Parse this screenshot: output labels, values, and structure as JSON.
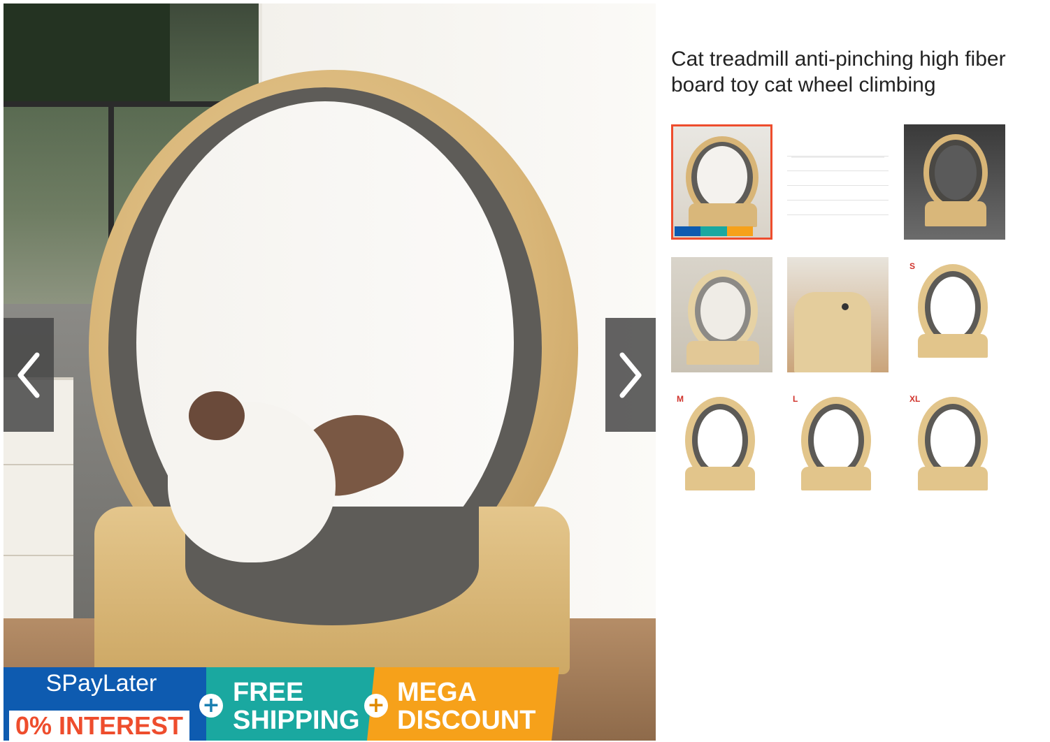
{
  "product": {
    "title": "Cat treadmill anti-pinching high fiber board toy cat wheel climbing"
  },
  "viewer": {
    "prev_icon": "chevron-left-icon",
    "next_icon": "chevron-right-icon"
  },
  "promo": {
    "spaylater": "SPayLater",
    "interest": "0% INTEREST",
    "free_line1": "FREE",
    "free_line2": "SHIPPING",
    "mega_line1": "MEGA",
    "mega_line2": "DISCOUNT",
    "colors": {
      "blue": "#0e5bb0",
      "teal": "#1aa8a0",
      "orange": "#f6a11a",
      "red": "#ee4d2d"
    }
  },
  "thumbnails": [
    {
      "label": "",
      "kind": "product-photo",
      "active": true
    },
    {
      "label": "",
      "kind": "size-table",
      "active": false
    },
    {
      "label": "",
      "kind": "dark-photo",
      "active": false
    },
    {
      "label": "",
      "kind": "angle-photo",
      "active": false
    },
    {
      "label": "",
      "kind": "detail-photo",
      "active": false
    },
    {
      "label": "S",
      "kind": "size-diagram",
      "active": false
    },
    {
      "label": "M",
      "kind": "size-diagram",
      "active": false
    },
    {
      "label": "L",
      "kind": "size-diagram",
      "active": false
    },
    {
      "label": "XL",
      "kind": "size-diagram",
      "active": false
    }
  ]
}
